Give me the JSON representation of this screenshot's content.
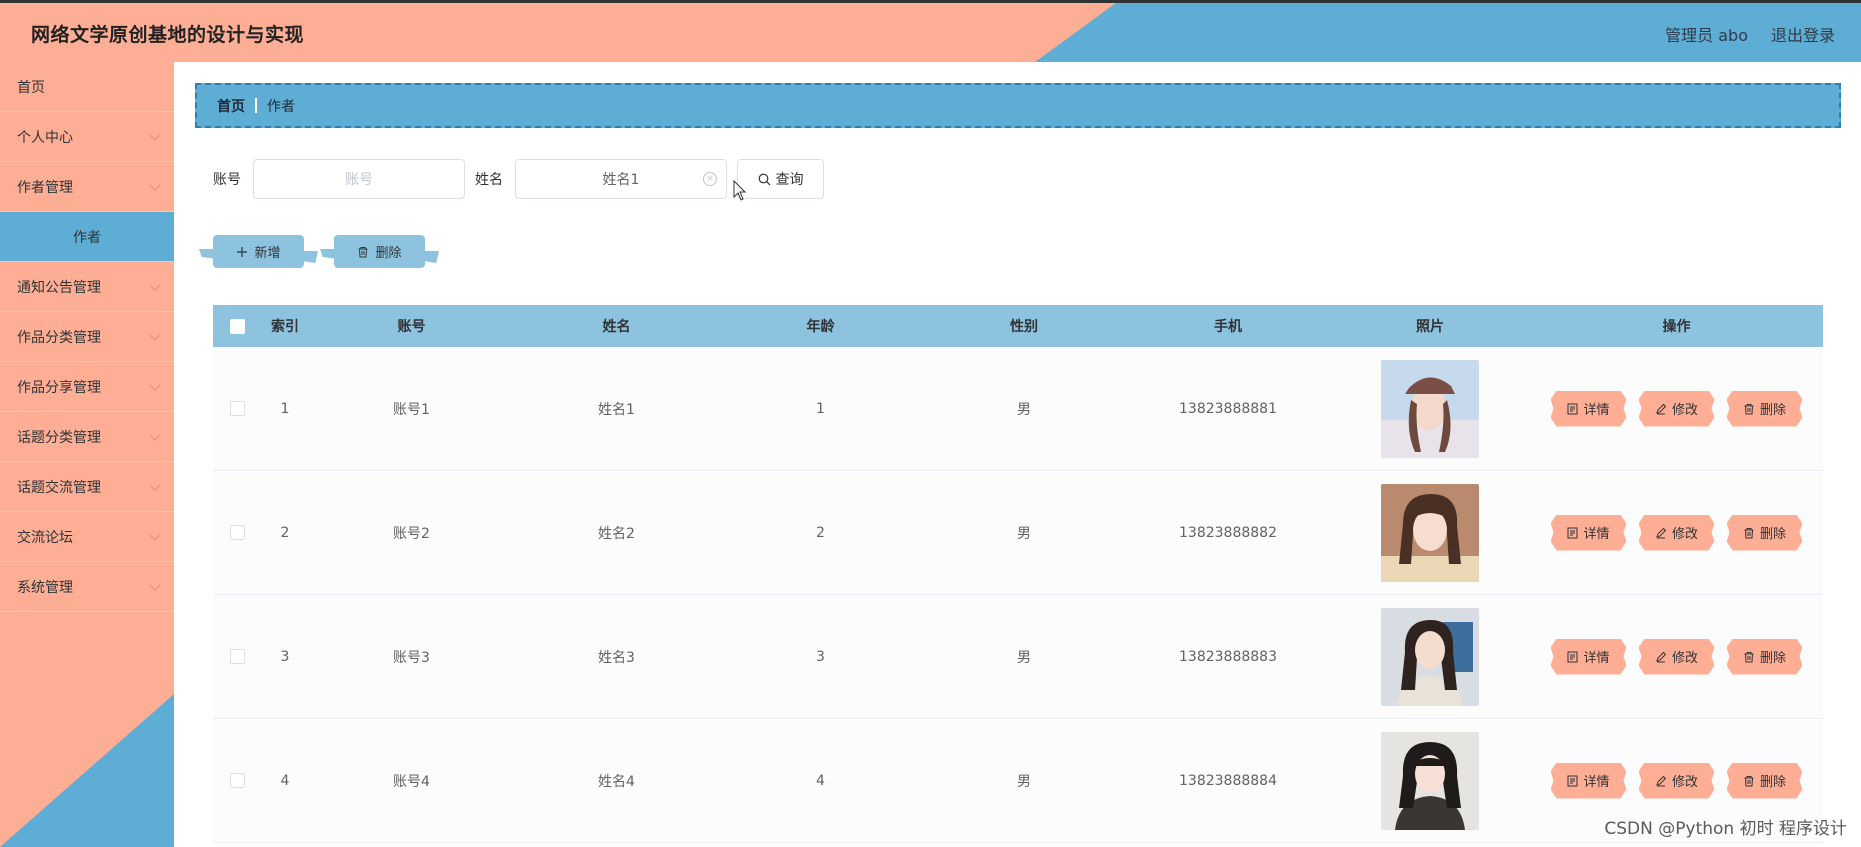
{
  "header": {
    "title": "网络文学原创基地的设计与实现",
    "user": "管理员 abo",
    "logout": "退出登录"
  },
  "sidebar": {
    "items": [
      {
        "label": "首页",
        "expandable": false
      },
      {
        "label": "个人中心",
        "expandable": true
      },
      {
        "label": "作者管理",
        "expandable": true
      },
      {
        "label": "作者",
        "sub": true
      },
      {
        "label": "通知公告管理",
        "expandable": true
      },
      {
        "label": "作品分类管理",
        "expandable": true
      },
      {
        "label": "作品分享管理",
        "expandable": true
      },
      {
        "label": "话题分类管理",
        "expandable": true
      },
      {
        "label": "话题交流管理",
        "expandable": true
      },
      {
        "label": "交流论坛",
        "expandable": true
      },
      {
        "label": "系统管理",
        "expandable": true
      }
    ]
  },
  "breadcrumb": {
    "home": "首页",
    "current": "作者"
  },
  "search": {
    "account_label": "账号",
    "account_placeholder": "账号",
    "name_label": "姓名",
    "name_value": "姓名1",
    "query_label": "查询"
  },
  "actions": {
    "add_label": "新增",
    "delete_label": "删除"
  },
  "table": {
    "columns": [
      "索引",
      "账号",
      "姓名",
      "年龄",
      "性别",
      "手机",
      "照片",
      "操作"
    ],
    "rows": [
      {
        "index": "1",
        "account": "账号1",
        "name": "姓名1",
        "age": "1",
        "sex": "男",
        "phone": "13823888881"
      },
      {
        "index": "2",
        "account": "账号2",
        "name": "姓名2",
        "age": "2",
        "sex": "男",
        "phone": "13823888882"
      },
      {
        "index": "3",
        "account": "账号3",
        "name": "姓名3",
        "age": "3",
        "sex": "男",
        "phone": "13823888883"
      },
      {
        "index": "4",
        "account": "账号4",
        "name": "姓名4",
        "age": "4",
        "sex": "男",
        "phone": "13823888884"
      }
    ],
    "ops": {
      "detail": "详情",
      "edit": "修改",
      "delete": "删除"
    }
  },
  "watermark": "CSDN @Python 初时 程序设计",
  "colors": {
    "salmon": "#fdae94",
    "blue": "#5eadd4",
    "light_blue": "#8ec3df"
  }
}
